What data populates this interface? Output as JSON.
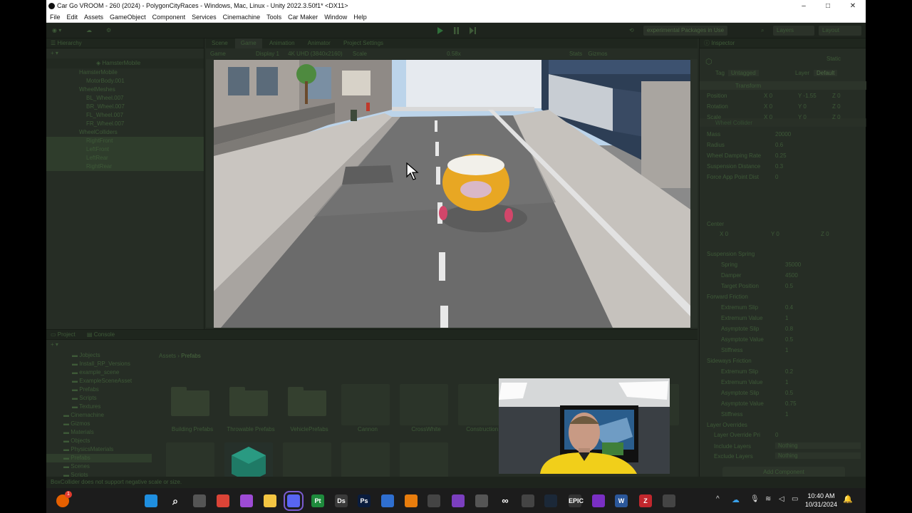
{
  "window": {
    "title": "Car Go VROOM - 260 (2024) - PolygonCityRaces - Windows, Mac, Linux - Unity 2022.3.50f1* <DX11>",
    "minimize": "–",
    "maximize": "□",
    "close": "✕"
  },
  "menu": [
    "File",
    "Edit",
    "Assets",
    "GameObject",
    "Component",
    "Services",
    "Cinemachine",
    "Tools",
    "Car Maker",
    "Window",
    "Help"
  ],
  "toolbar": {
    "package_dropdown": "experimental Packages in Use",
    "layers_dropdown": "Layers",
    "layout_dropdown": "Layout"
  },
  "hierarchy": {
    "tab": "Hierarchy",
    "root": "HamsterMobile",
    "items": [
      {
        "label": "HamsterMobile",
        "indent": 1
      },
      {
        "label": "MotorBody.001",
        "indent": 2
      },
      {
        "label": "WheelMeshes",
        "indent": 1
      },
      {
        "label": "BL_Wheel.007",
        "indent": 2
      },
      {
        "label": "BR_Wheel.007",
        "indent": 2
      },
      {
        "label": "FL_Wheel.007",
        "indent": 2
      },
      {
        "label": "FR_Wheel.007",
        "indent": 2
      },
      {
        "label": "WheelColliders",
        "indent": 1
      },
      {
        "label": "RightFront",
        "indent": 2,
        "highlight": true
      },
      {
        "label": "LeftFront",
        "indent": 2,
        "highlight": true
      },
      {
        "label": "LeftRear",
        "indent": 2,
        "highlight": true
      },
      {
        "label": "RightRear",
        "indent": 2,
        "highlight": true
      }
    ]
  },
  "scene_tabs": [
    "Scene",
    "Game",
    "Animation",
    "Animator",
    "Project Settings"
  ],
  "game_bar": {
    "mode": "Game",
    "display": "Display 1",
    "resolution": "4K UHD (3840x2160)",
    "scale_label": "Scale",
    "scale_value": "0.58x",
    "stats": "Stats",
    "gizmos": "Gizmos"
  },
  "inspector": {
    "tab": "Inspector",
    "static_label": "Static",
    "tag_label": "Tag",
    "tag_value": "Untagged",
    "layer_label": "Layer",
    "layer_value": "Default",
    "transform": {
      "header": "Transform",
      "rows": [
        {
          "label": "Position",
          "x": "0",
          "y": "-1.55",
          "z": "0"
        },
        {
          "label": "Rotation",
          "x": "0",
          "y": "0",
          "z": "0"
        },
        {
          "label": "Scale",
          "x": "0",
          "y": "0",
          "z": "0"
        }
      ]
    },
    "wheel_collider": {
      "header": "Wheel Collider",
      "rows": [
        {
          "label": "Mass",
          "value": "20000"
        },
        {
          "label": "Radius",
          "value": "0.6"
        },
        {
          "label": "Wheel Damping Rate",
          "value": "0.25"
        },
        {
          "label": "Suspension Distance",
          "value": "0.3"
        },
        {
          "label": "Force App Point Dist",
          "value": "0"
        }
      ],
      "center_label": "Center",
      "center": {
        "x": "0",
        "y": "0",
        "z": "0"
      },
      "suspension_spring": {
        "header": "Suspension Spring",
        "rows": [
          {
            "label": "Spring",
            "value": "35000"
          },
          {
            "label": "Damper",
            "value": "4500"
          },
          {
            "label": "Target Position",
            "value": "0.5"
          }
        ]
      },
      "forward_friction": {
        "header": "Forward Friction",
        "rows": [
          {
            "label": "Extremum Slip",
            "value": "0.4"
          },
          {
            "label": "Extremum Value",
            "value": "1"
          },
          {
            "label": "Asymptote Slip",
            "value": "0.8"
          },
          {
            "label": "Asymptote Value",
            "value": "0.5"
          },
          {
            "label": "Stiffness",
            "value": "1"
          }
        ]
      },
      "sideways_friction": {
        "header": "Sideways Friction",
        "rows": [
          {
            "label": "Extremum Slip",
            "value": "0.2"
          },
          {
            "label": "Extremum Value",
            "value": "1"
          },
          {
            "label": "Asymptote Slip",
            "value": "0.5"
          },
          {
            "label": "Asymptote Value",
            "value": "0.75"
          },
          {
            "label": "Stiffness",
            "value": "1"
          }
        ]
      },
      "layer_overrides": {
        "header": "Layer Overrides",
        "priority_label": "Layer Override Pri",
        "priority_value": "0",
        "include_label": "Include Layers",
        "include_value": "Nothing",
        "exclude_label": "Exclude Layers",
        "exclude_value": "Nothing"
      }
    },
    "add_component": "Add Component"
  },
  "project": {
    "tabs": [
      "Project",
      "Console"
    ],
    "breadcrumb": [
      "Assets",
      "Prefabs"
    ],
    "tree": [
      {
        "label": "Jobjects",
        "indent": 2
      },
      {
        "label": "Install_RP_Versions",
        "indent": 2
      },
      {
        "label": "example_scene",
        "indent": 2
      },
      {
        "label": "ExampleSceneAsset",
        "indent": 2
      },
      {
        "label": "Prefabs",
        "indent": 2
      },
      {
        "label": "Scripts",
        "indent": 2
      },
      {
        "label": "Textures",
        "indent": 2
      },
      {
        "label": "Cinemachine",
        "indent": 1
      },
      {
        "label": "Gizmos",
        "indent": 1
      },
      {
        "label": "Materials",
        "indent": 1
      },
      {
        "label": "Objects",
        "indent": 1
      },
      {
        "label": "PhysicsMaterials",
        "indent": 1
      },
      {
        "label": "Prefabs",
        "indent": 1,
        "highlight": true
      },
      {
        "label": "Scenes",
        "indent": 1
      },
      {
        "label": "Scripts",
        "indent": 1
      }
    ],
    "assets": [
      "Building Prefabs",
      "Throwable Prefabs",
      "VehiclePrefabs",
      "Cannon",
      "CrossWhite",
      "Construction..."
    ]
  },
  "status": "BoxCollider does not support negative scale or size.",
  "taskbar": {
    "time": "10:40 AM",
    "date": "10/31/2024",
    "badge": "1",
    "icons": [
      "windows-icon",
      "search-icon",
      "taskview-icon",
      "chrome-icon",
      "github-icon",
      "explorer-icon",
      "discord-icon",
      "pycharm-icon",
      "davinci-icon",
      "photoshop-icon",
      "grid-app-icon",
      "blender-icon",
      "unity-hub-icon",
      "visual-studio-icon",
      "zbrush-icon",
      "meta-icon",
      "oculus-icon",
      "steam-icon",
      "epic-icon",
      "obs-icon",
      "word-icon",
      "app-z-icon",
      "unity-icon"
    ],
    "labels": {
      "pycharm-icon": "Pt",
      "davinci-icon": "Ds",
      "photoshop-icon": "Ps",
      "epic-icon": "EPIC",
      "word-icon": "W",
      "app-z-icon": "Z"
    }
  }
}
